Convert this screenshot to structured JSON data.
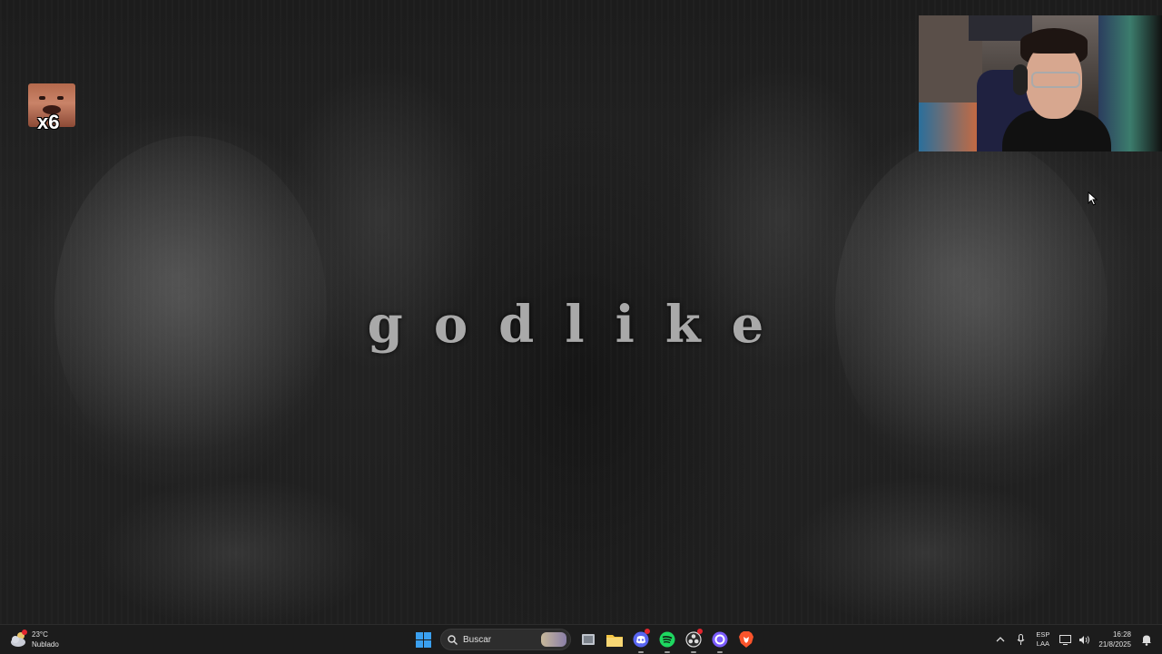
{
  "wallpaper": {
    "title": "godlike"
  },
  "overlay": {
    "emote_count": "x6"
  },
  "taskbar": {
    "weather": {
      "temperature": "23°C",
      "condition": "Nublado",
      "icon": "cloud-moon-icon"
    },
    "start_icon": "windows-start-icon",
    "search_placeholder": "Buscar",
    "pinned_apps": [
      {
        "name": "task-view",
        "icon": "task-view-icon"
      },
      {
        "name": "file-explorer",
        "icon": "folder-icon"
      },
      {
        "name": "discord",
        "icon": "discord-icon"
      },
      {
        "name": "spotify",
        "icon": "spotify-icon"
      },
      {
        "name": "obs",
        "icon": "obs-icon"
      },
      {
        "name": "app-ring",
        "icon": "ring-app-icon"
      },
      {
        "name": "brave",
        "icon": "brave-icon"
      }
    ],
    "tray": {
      "language_line1": "ESP",
      "language_line2": "LAA",
      "time": "16:28",
      "date": "21/8/2025"
    }
  },
  "colors": {
    "taskbar_bg": "#1c1c1c",
    "windows_blue": "#3aa0f0",
    "spotify_green": "#1ed760",
    "discord_blurple": "#5865f2",
    "brave_orange": "#fb542b",
    "folder_yellow": "#f4c542",
    "ring_purple": "#7b5cff",
    "badge_red": "#e2252f"
  }
}
